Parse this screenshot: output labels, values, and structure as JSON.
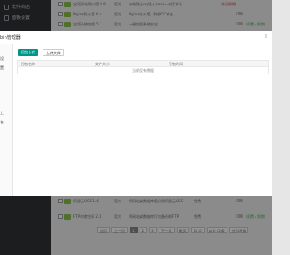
{
  "sidebar": {
    "items": [
      {
        "label": "软件商店"
      },
      {
        "label": "面板设置"
      }
    ]
  },
  "background_rows": [
    {
      "name": "宝塔网站防火墙 8.9",
      "dev": "官方",
      "desc": "有效防止sql注入/xss/一句话木马",
      "status": "今日到期"
    },
    {
      "name": "Nginx防火墙 6.4",
      "dev": "官方",
      "desc": "Nginx防火墙，防御CC攻击",
      "status": ""
    },
    {
      "name": "宝塔系统加固 5.1",
      "dev": "官方",
      "desc": "一键加固系统安全",
      "status": "续费 / 到期"
    }
  ],
  "background_bottom_rows": [
    {
      "name": "阿里云OSS 1.6",
      "dev": "官方",
      "desc": "将网站或数据库备份到阿里云OSS",
      "price": "免费"
    },
    {
      "name": "FTP存储空间 2.1",
      "dev": "官方",
      "desc": "将网站或数据库打包备份到FTP",
      "price": "免费",
      "status": "续费 / 到期"
    }
  ],
  "pagination": {
    "items": [
      "首页",
      "上一页",
      "1",
      "2",
      "3",
      "下一页",
      "尾页",
      "1/10",
      "从1-15条",
      "共149条"
    ],
    "active_index": 2
  },
  "modal": {
    "title": "bin管理器",
    "close_glyph": "×",
    "nav": [
      "",
      "设",
      "置",
      "",
      "上",
      "名"
    ],
    "upload_button": "打包上传",
    "upload_file_button": "上传文件",
    "table": {
      "headers": [
        "打包名称",
        "文件大小",
        "打包时间"
      ],
      "empty_text": "当前没有数据"
    }
  },
  "colors": {
    "accent": "#009688",
    "sidebar": "#2f3336",
    "success": "#4caf50",
    "danger": "#e53935"
  }
}
